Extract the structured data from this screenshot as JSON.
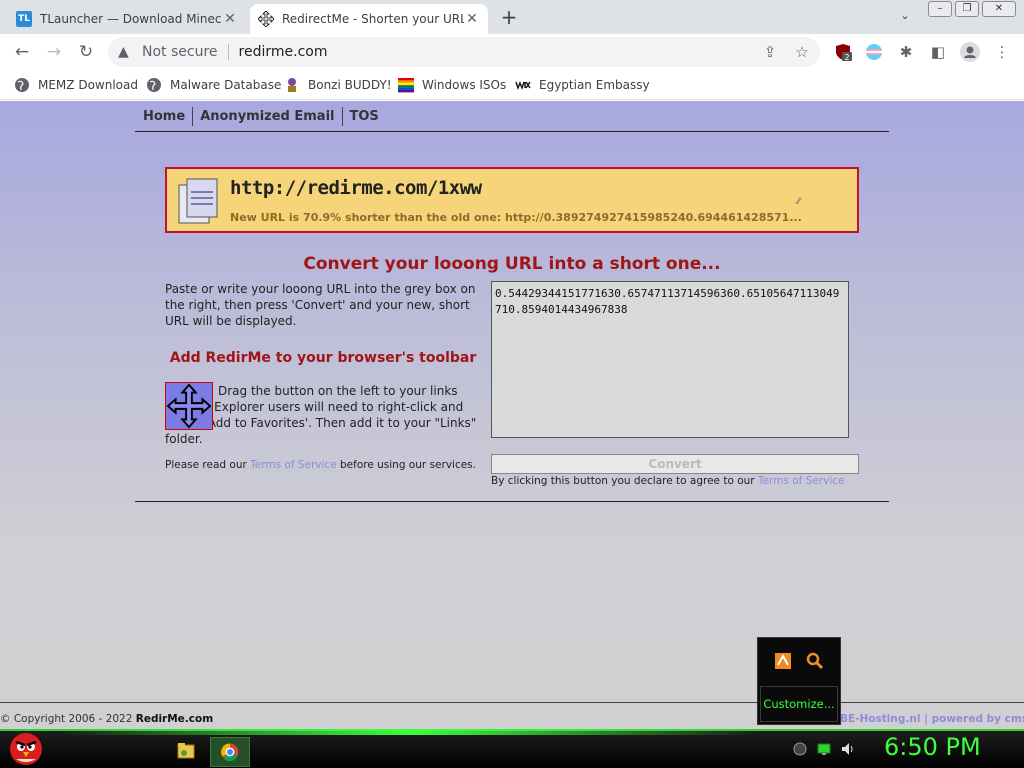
{
  "browser": {
    "tabs": [
      {
        "title": "TLauncher — Download Minecraft",
        "favicon": "TL",
        "active": false
      },
      {
        "title": "RedirectMe - Shorten your URL for free",
        "active": true
      }
    ],
    "new_tab": "+",
    "address": {
      "security": "Not secure",
      "url": "redirme.com"
    },
    "bookmarks": [
      {
        "label": "MEMZ Download",
        "icon": "globe-icon"
      },
      {
        "label": "Malware Database",
        "icon": "globe-icon"
      },
      {
        "label": "Bonzi BUDDY!",
        "icon": "bonzi-icon"
      },
      {
        "label": "Windows ISOs",
        "icon": "rainbow-flag-icon"
      },
      {
        "label": "Egyptian Embassy",
        "icon": "wix-icon"
      }
    ],
    "extension_badge": "2"
  },
  "site": {
    "nav": [
      "Home",
      "Anonymized Email",
      "TOS"
    ],
    "result": {
      "short_url": "http://redirme.com/1xww",
      "message": "New URL is 70.9% shorter than the old one: http://0.389274927415985240.694461428571..."
    },
    "headline": "Convert your looong URL into a short one...",
    "intro": "Paste or write your looong URL into the grey box on the right, then press 'Convert' and your new, short URL will be displayed.",
    "toolbar_title": "Add RedirMe to your browser's toolbar",
    "drag_text": "Drag the button on the left to your links toolbar. Explorer users will need to right-click and select 'Add to Favorites'. Then add it to your \"Links\" folder.",
    "read_tos_prefix": "Please read our ",
    "read_tos_link": "Terms of Service",
    "read_tos_suffix": " before using our services.",
    "url_input_value": "0.54429344151771630.65747113714596360.65105647113049710.8594014434967838",
    "convert_label": "Convert",
    "agree_prefix": "By clicking this button you declare to agree to our ",
    "agree_link": "Terms of Service",
    "copyright_prefix": "© Copyright 2006 - 2022 ",
    "copyright_brand": "RedirMe.com",
    "credits": "BE-Hosting.nl  |  powered by cmsGear"
  },
  "tray_popup": {
    "customize_label": "Customize..."
  },
  "taskbar": {
    "clock": "6:50 PM"
  },
  "colors": {
    "accent_red": "#a01515",
    "result_bg": "#f6d47a",
    "clock_green": "#3cff3c"
  }
}
